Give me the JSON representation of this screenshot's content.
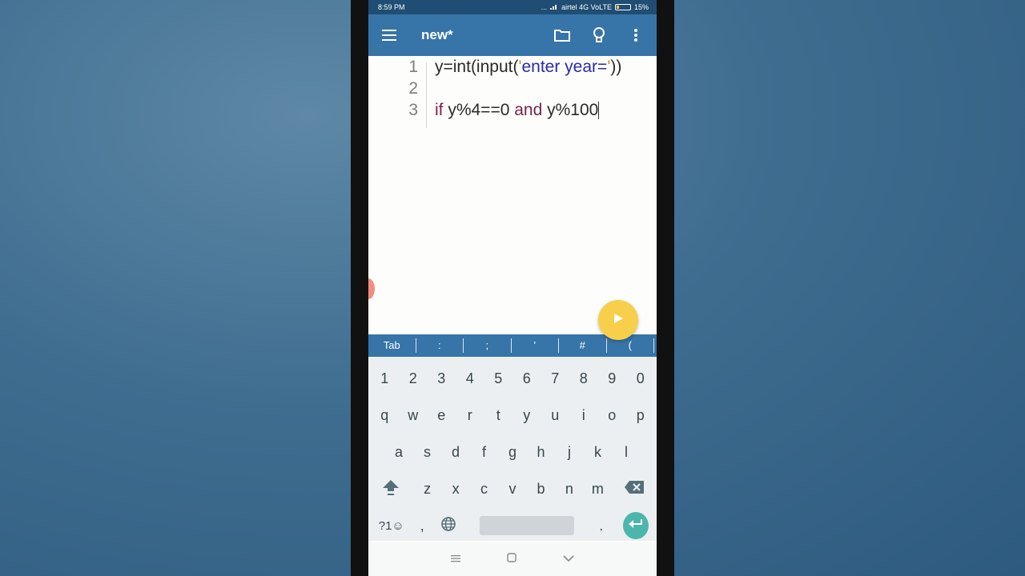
{
  "status": {
    "time": "8:59 PM",
    "carrier": "airtel 4G VoLTE",
    "battery": "15%",
    "dots": "..."
  },
  "appbar": {
    "title": "new*"
  },
  "editor": {
    "lines": [
      {
        "num": "1",
        "code": "y=int(input('enter year='))"
      },
      {
        "num": "2",
        "code": ""
      },
      {
        "num": "3",
        "code": "if y%4==0 and y%100"
      }
    ],
    "l1_a": "y=int(input(",
    "l1_q1": "'",
    "l1_str": "enter year=",
    "l1_q2": "'",
    "l1_end": "))",
    "l3_if": "if",
    "l3_mid": " y%4==0 ",
    "l3_and": "and",
    "l3_end": " y%100"
  },
  "symbols": [
    "Tab",
    ":",
    ";",
    "'",
    "#",
    "("
  ],
  "keyboard": {
    "row_numbers": [
      "1",
      "2",
      "3",
      "4",
      "5",
      "6",
      "7",
      "8",
      "9",
      "0"
    ],
    "row1": [
      "q",
      "w",
      "e",
      "r",
      "t",
      "y",
      "u",
      "i",
      "o",
      "p"
    ],
    "row2": [
      "a",
      "s",
      "d",
      "f",
      "g",
      "h",
      "j",
      "k",
      "l"
    ],
    "row3": [
      "z",
      "x",
      "c",
      "v",
      "b",
      "n",
      "m"
    ],
    "symbols_key": "?1☺",
    "comma": ",",
    "period": "."
  },
  "icons": {
    "menu": "menu-icon",
    "folder": "folder-icon",
    "bulb": "lightbulb-icon",
    "more": "more-vert-icon",
    "run": "play-icon"
  },
  "colors": {
    "appbar": "#3774a8",
    "fab": "#f7cf4b",
    "enter": "#4db6ac",
    "keyword": "#7a1f4a",
    "string": "#2a2aa8"
  }
}
